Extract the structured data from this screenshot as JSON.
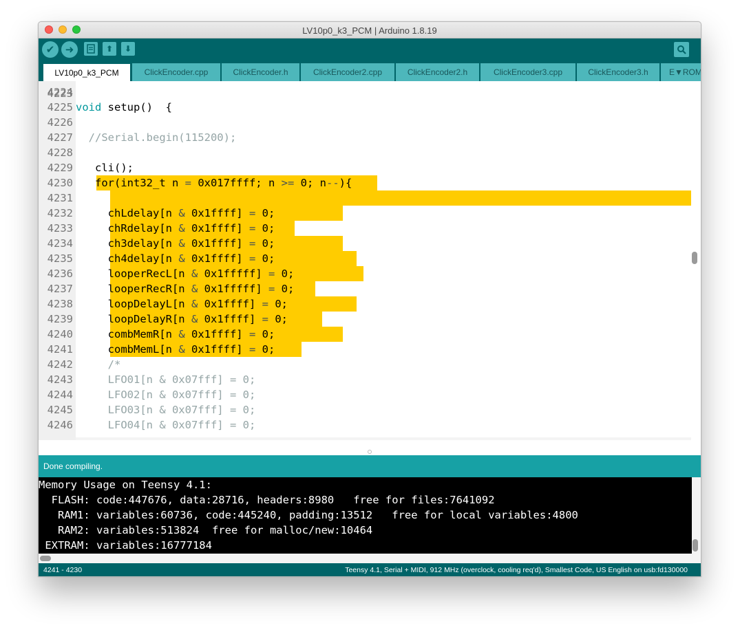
{
  "window": {
    "title": "LV10p0_k3_PCM | Arduino 1.8.19"
  },
  "toolbar": {
    "verify_icon": "check-icon",
    "upload_icon": "arrow-right-icon",
    "new_icon": "file-icon",
    "open_icon": "arrow-up-icon",
    "save_icon": "arrow-down-icon",
    "serial_icon": "magnifier-icon"
  },
  "tabs": [
    {
      "label": "LV10p0_k3_PCM",
      "active": true
    },
    {
      "label": "ClickEncoder.cpp"
    },
    {
      "label": "ClickEncoder.h"
    },
    {
      "label": "ClickEncoder2.cpp"
    },
    {
      "label": "ClickEncoder2.h"
    },
    {
      "label": "ClickEncoder3.cpp"
    },
    {
      "label": "ClickEncoder3.h"
    },
    {
      "label": "E▼ROM"
    }
  ],
  "editor": {
    "partial_line_number": "4223",
    "lines": [
      {
        "num": "4224",
        "code": ""
      },
      {
        "num": "4225",
        "code": "void setup()  {"
      },
      {
        "num": "4226",
        "code": ""
      },
      {
        "num": "4227",
        "code": "  //Serial.begin(115200);"
      },
      {
        "num": "4228",
        "code": ""
      },
      {
        "num": "4229",
        "code": "   cli();"
      },
      {
        "num": "4230",
        "code": "   for(int32_t n = 0x017ffff; n >= 0; n--){"
      },
      {
        "num": "4231",
        "code": ""
      },
      {
        "num": "4232",
        "code": "     chLdelay[n & 0x1ffff] = 0;"
      },
      {
        "num": "4233",
        "code": "     chRdelay[n & 0x1ffff] = 0;"
      },
      {
        "num": "4234",
        "code": "     ch3delay[n & 0x1ffff] = 0;"
      },
      {
        "num": "4235",
        "code": "     ch4delay[n & 0x1ffff] = 0;"
      },
      {
        "num": "4236",
        "code": "     looperRecL[n & 0x1fffff] = 0;"
      },
      {
        "num": "4237",
        "code": "     looperRecR[n & 0x1fffff] = 0;"
      },
      {
        "num": "4238",
        "code": "     loopDelayL[n & 0x1ffff] = 0;"
      },
      {
        "num": "4239",
        "code": "     loopDelayR[n & 0x1ffff] = 0;"
      },
      {
        "num": "4240",
        "code": "     combMemR[n & 0x1ffff] = 0;"
      },
      {
        "num": "4241",
        "code": "     combMemL[n & 0x1ffff] = 0;"
      },
      {
        "num": "4242",
        "code": "     /*"
      },
      {
        "num": "4243",
        "code": "     LFO01[n & 0x07fff] = 0;"
      },
      {
        "num": "4244",
        "code": "     LFO02[n & 0x07fff] = 0;"
      },
      {
        "num": "4245",
        "code": "     LFO03[n & 0x07fff] = 0;"
      },
      {
        "num": "4246",
        "code": "     LFO04[n & 0x07fff] = 0;"
      }
    ]
  },
  "status": {
    "message": "Done compiling."
  },
  "console": {
    "lines": [
      "Memory Usage on Teensy 4.1:",
      "  FLASH: code:447676, data:28716, headers:8980   free for files:7641092",
      "   RAM1: variables:60736, code:445240, padding:13512   free for local variables:4800",
      "   RAM2: variables:513824  free for malloc/new:10464",
      " EXTRAM: variables:16777184"
    ]
  },
  "bottom": {
    "selection": "4241 - 4230",
    "board": "Teensy 4.1, Serial + MIDI, 912 MHz (overclock, cooling req'd), Smallest Code, US English on usb:fd130000"
  },
  "colors": {
    "toolbar": "#006468",
    "tab_inactive": "#4db7bb",
    "status": "#17a1a5",
    "selection": "#ffcc00",
    "keyword": "#00979c",
    "function": "#5e6d03",
    "comment": "#95a5a6"
  }
}
